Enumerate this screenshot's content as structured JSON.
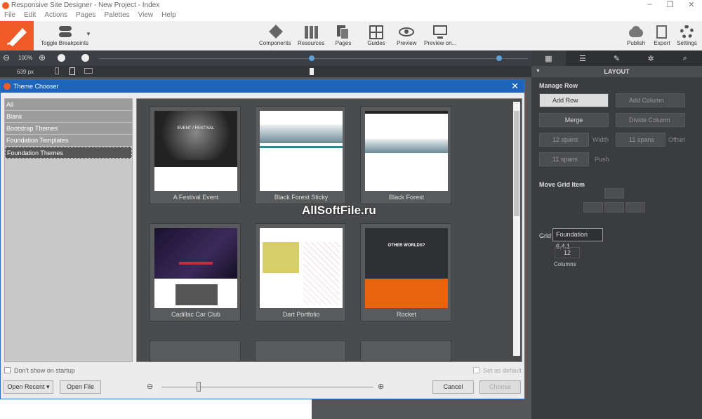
{
  "window": {
    "title": "Responsive Site Designer - New Project - Index",
    "controls": [
      "–",
      "❐",
      "✕"
    ]
  },
  "menu": [
    "File",
    "Edit",
    "Actions",
    "Pages",
    "Palettes",
    "View",
    "Help"
  ],
  "toolbar": {
    "toggle_breakpoints": "Toggle Breakpoints",
    "components": "Components",
    "resources": "Resources",
    "pages": "Pages",
    "guides": "Guides",
    "preview": "Preview",
    "preview_on": "Preview on...",
    "publish": "Publish",
    "export": "Export",
    "settings": "Settings"
  },
  "zoom": {
    "value": "100%",
    "width": "639 px"
  },
  "right_panel": {
    "section": "LAYOUT",
    "manage_row": "Manage Row",
    "add_row": "Add Row",
    "add_column": "Add Column",
    "merge": "Merge",
    "divide_column": "Divide Column",
    "spans1": "12 spans",
    "width": "Width",
    "spans2": "11 spans",
    "offset": "Offset",
    "spans3": "11 spans",
    "push": "Push",
    "move_grid_item": "Move Grid Item",
    "grid": "Grid",
    "grid_value": "Foundation 6.4.1",
    "columns_value": "12",
    "columns": "Columns"
  },
  "dialog": {
    "title": "Theme Chooser",
    "categories": [
      "All",
      "Blank",
      "Bootstrap Themes",
      "Foundation Templates",
      "Foundation Themes"
    ],
    "themes": [
      "A Festival Event",
      "Black Forest Sticky",
      "Black Forest",
      "Cadillac Car Club",
      "Dart Portfolio",
      "Rocket"
    ],
    "thumb_text": {
      "festival": "EVENT / FESTIVAL",
      "rocket": "OTHER WORLDS?"
    },
    "dont_show": "Don't show on startup",
    "set_default": "Set as default",
    "open_recent": "Open Recent",
    "open_file": "Open File",
    "cancel": "Cancel",
    "choose": "Choose"
  },
  "watermark": "AllSoftFile.ru"
}
